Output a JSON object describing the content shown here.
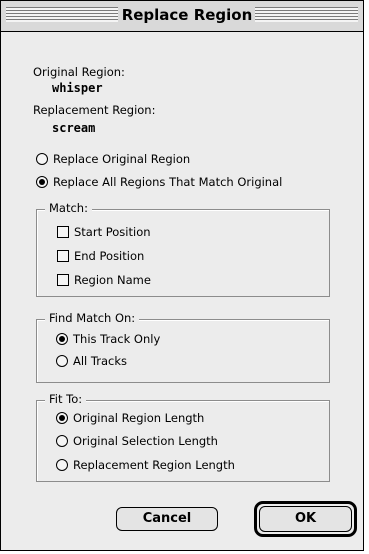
{
  "dialog": {
    "title": "Replace Region",
    "original_region_label": "Original Region:",
    "original_region_value": "whisper",
    "replacement_region_label": "Replacement Region:",
    "replacement_region_value": "scream"
  },
  "mode_options": [
    {
      "label": "Replace Original Region",
      "selected": false
    },
    {
      "label": "Replace All Regions That Match Original",
      "selected": true
    }
  ],
  "match": {
    "legend": "Match:",
    "items": [
      {
        "label": "Start Position",
        "checked": false
      },
      {
        "label": "End Position",
        "checked": false
      },
      {
        "label": "Region Name",
        "checked": false
      }
    ]
  },
  "find_match_on": {
    "legend": "Find Match On:",
    "options": [
      {
        "label": "This Track Only",
        "selected": true
      },
      {
        "label": "All Tracks",
        "selected": false
      }
    ]
  },
  "fit_to": {
    "legend": "Fit To:",
    "options": [
      {
        "label": "Original Region Length",
        "selected": true
      },
      {
        "label": "Original Selection Length",
        "selected": false
      },
      {
        "label": "Replacement Region Length",
        "selected": false
      }
    ]
  },
  "buttons": {
    "cancel": "Cancel",
    "ok": "OK"
  }
}
